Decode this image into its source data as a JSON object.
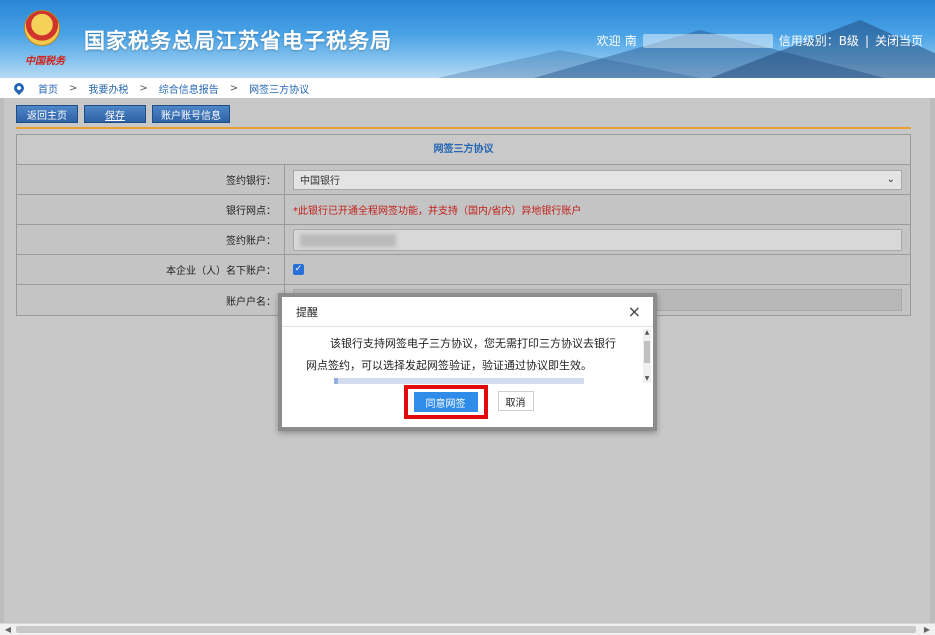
{
  "header": {
    "site_title": "国家税务总局江苏省电子税务局",
    "emblem_caption": "中国税务",
    "welcome": "欢迎",
    "welcome_name_initial": "南",
    "credit_level": "信用级别：B级",
    "separator": "|",
    "close_page": "关闭当页"
  },
  "breadcrumb": {
    "items": [
      "首页",
      "我要办税",
      "综合信息报告",
      "网签三方协议"
    ],
    "separator": ">"
  },
  "toolbar": {
    "back_label": "返回主页",
    "save_label": "保存",
    "account_info_label": "账户账号信息"
  },
  "form": {
    "title": "网签三方协议",
    "rows": {
      "bank": {
        "label": "签约银行：",
        "value": "中国银行"
      },
      "branch": {
        "label": "银行网点：",
        "note": "*此银行已开通全程网签功能，并支持（国内/省内）异地银行账户"
      },
      "account": {
        "label": "签约账户："
      },
      "own_account": {
        "label": "本企业（人）名下账户：",
        "checked": true
      },
      "account_name": {
        "label": "账户户名："
      }
    }
  },
  "modal": {
    "title": "提醒",
    "close_glyph": "×",
    "message_line1": "该银行支持网签电子三方协议，您无需打印三方协议去银行",
    "message_line2": "网点签约，可以选择发起网签验证，验证通过协议即生效。",
    "agree_label": "同意网签",
    "cancel_label": "取消"
  },
  "colors": {
    "accent_blue": "#2f8ce8",
    "highlight_red": "#e10b0b",
    "divider_orange": "#e8a030",
    "warning_red": "#c0201a"
  }
}
